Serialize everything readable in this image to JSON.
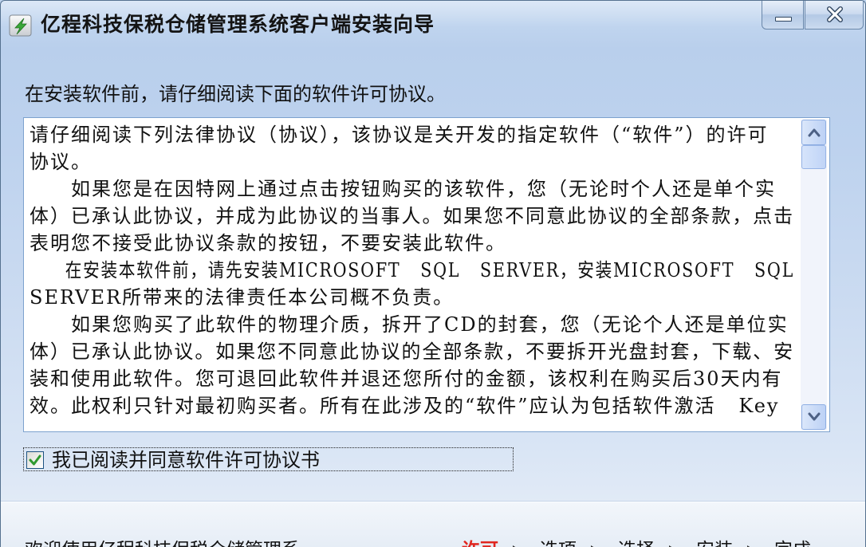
{
  "window": {
    "title": "亿程科技保税仓储管理系统客户端安装向导",
    "app_icon": "installer-bolt-icon",
    "minimize_icon": "minimize-icon",
    "close_icon": "close-icon"
  },
  "intro": {
    "label": "在安装软件前，请仔细阅读下面的软件许可协议。"
  },
  "license": {
    "lines": [
      "请仔细阅读下列法律协议（协议），该协议是关开发的指定软件（“软件”）的许可",
      "协议。",
      "　　如果您是在因特网上通过点击按钮购买的该软件，您（无论时个人还是单个实",
      "体）已承认此协议，并成为此协议的当事人。如果您不同意此协议的全部条款，点击",
      "表明您不接受此协议条款的按钮，不要安装此软件。",
      "　　在安装本软件前，请先安装MICROSOFT   SQL   SERVER，安装MICROSOFT   SQL",
      "SERVER所带来的法律责任本公司概不负责。",
      "　　如果您购买了此软件的物理介质，拆开了CD的封套，您（无论个人还是单位实",
      "体）已承认此协议。如果您不同意此协议的全部条款，不要拆开光盘封套，下载、安",
      "装和使用此软件。您可退回此软件并退还您所付的金额，该权利在购买后30天内有",
      "效。此权利只针对最初购买者。所有在此涉及的“软件”应认为包括软件激活   Key"
    ],
    "scroll_fraction": 0,
    "scroll_up_icon": "chevron-up-icon",
    "scroll_down_icon": "chevron-down-icon"
  },
  "agree": {
    "label": "我已阅读并同意软件许可协议书",
    "checked": true,
    "check_icon": "checkmark-icon"
  },
  "footer": {
    "welcome": "欢迎使用亿程科技保税仓储管理系",
    "steps": [
      {
        "label": "许可",
        "active": true
      },
      {
        "label": "选项",
        "active": false
      },
      {
        "label": "选择",
        "active": false
      },
      {
        "label": "安装",
        "active": false
      },
      {
        "label": "完成",
        "active": false
      }
    ]
  },
  "colors": {
    "accent_border": "#7da2ce",
    "check_mark": "#2f9a2f",
    "active_step": "#e0261f"
  }
}
